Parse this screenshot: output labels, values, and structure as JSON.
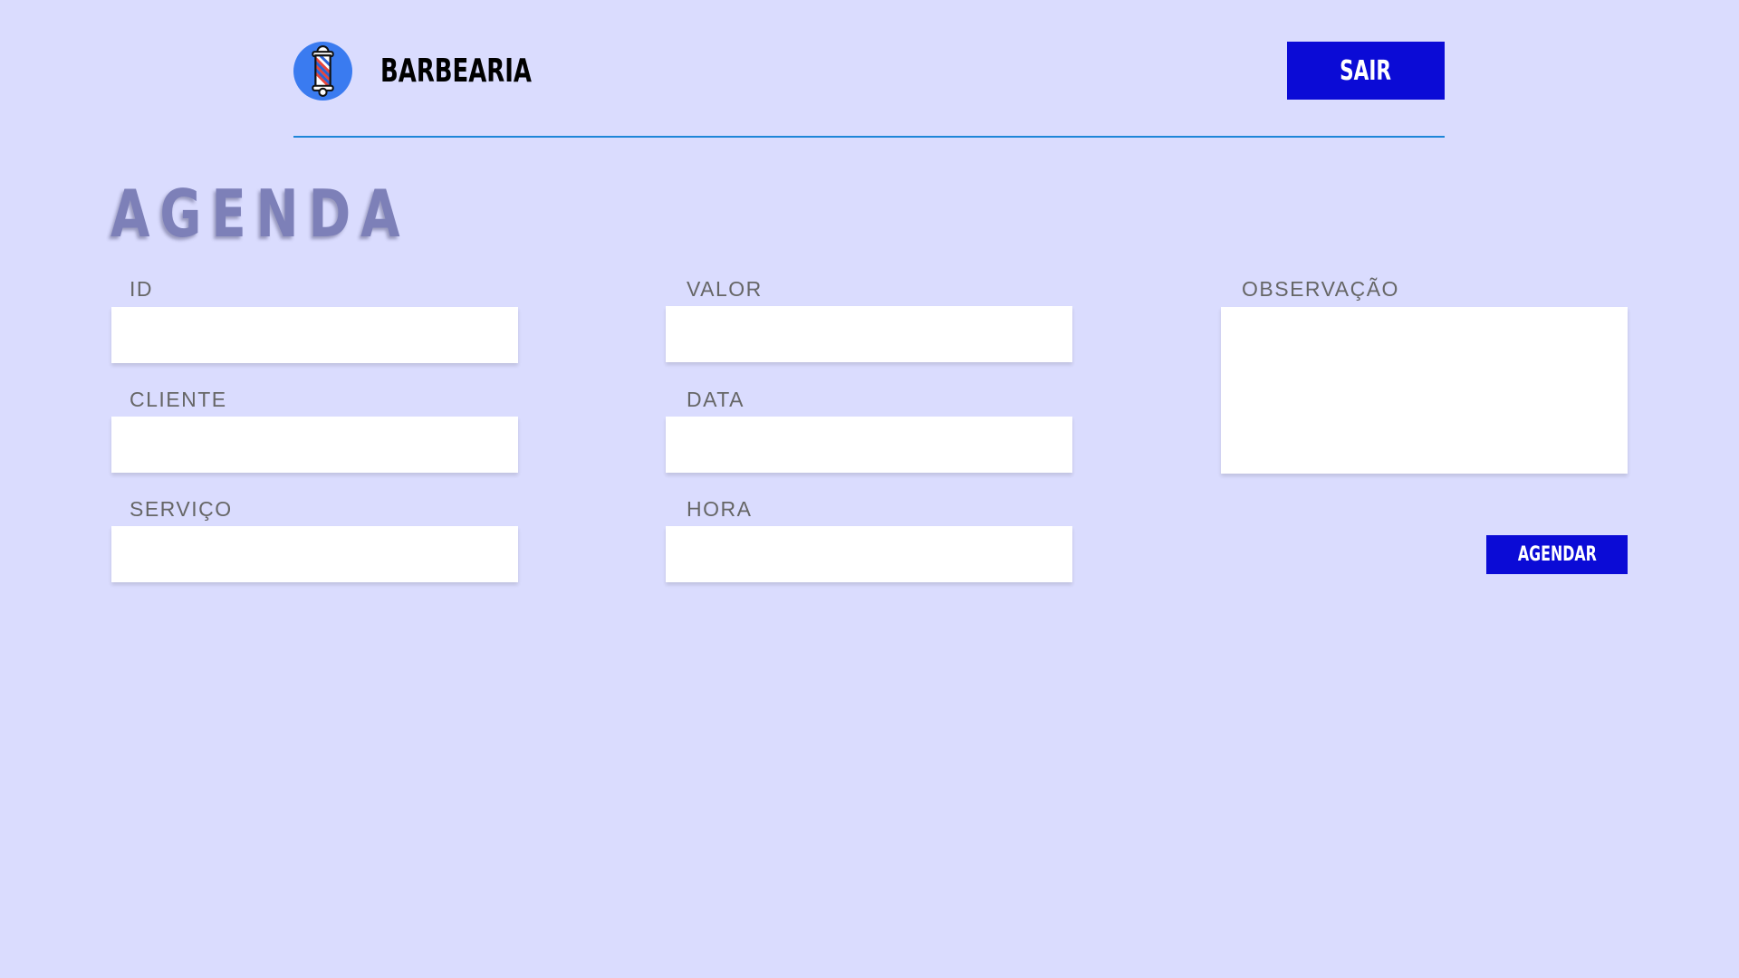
{
  "header": {
    "brand_name": "BARBEARIA",
    "logout_label": "SAIR",
    "logo_icon": "barber-pole-icon"
  },
  "page": {
    "title": "AGENDA"
  },
  "form": {
    "fields": {
      "id": {
        "label": "ID",
        "value": "",
        "placeholder": ""
      },
      "cliente": {
        "label": "CLIENTE",
        "value": "",
        "placeholder": ""
      },
      "servico": {
        "label": "SERVIÇO",
        "value": "",
        "placeholder": ""
      },
      "valor": {
        "label": "VALOR",
        "value": "",
        "placeholder": ""
      },
      "data": {
        "label": "DATA",
        "value": "",
        "placeholder": ""
      },
      "hora": {
        "label": "HORA",
        "value": "",
        "placeholder": ""
      },
      "observacao": {
        "label": "OBSERVAÇÃO",
        "value": "",
        "placeholder": ""
      }
    },
    "submit_label": "AGENDAR"
  },
  "colors": {
    "background": "#dadcfe",
    "accent": "#0b0bd6",
    "divider": "#1e86d8",
    "title": "#7d80b8",
    "label": "#666666",
    "logo_circle": "#3a7bf0"
  }
}
